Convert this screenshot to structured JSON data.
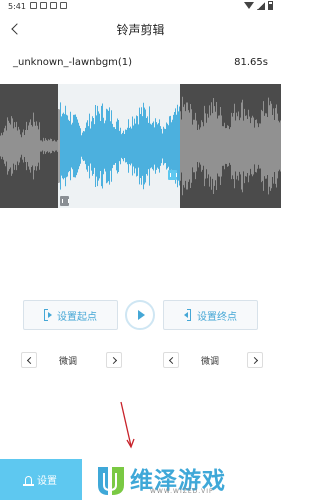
{
  "status_bar": {
    "time": "5:41"
  },
  "header": {
    "title": "铃声剪辑"
  },
  "file": {
    "name": "_unknown_-lawnbgm(1)",
    "duration": "81.65s"
  },
  "waveform": {
    "selection_start_fraction": 0.21,
    "selection_end_fraction": 0.64,
    "wave_color": "#9a9a9a",
    "selected_wave_color": "#3aa9dc"
  },
  "controls": {
    "set_start_label": "设置起点",
    "set_end_label": "设置终点"
  },
  "fine_tune": {
    "left_label": "微调",
    "right_label": "微调"
  },
  "bottom": {
    "settings_label": "设置"
  },
  "watermark": {
    "text": "维泽游戏",
    "sub": "WWW.WIZED.VIP"
  },
  "colors": {
    "accent": "#45a7d6",
    "button_bg": "#5ec8f0"
  }
}
